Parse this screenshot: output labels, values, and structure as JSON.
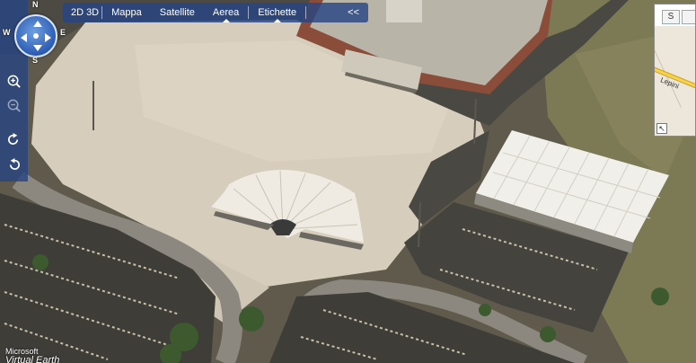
{
  "toolbar": {
    "mode_2d": "2D",
    "mode_3d": "3D",
    "items": [
      {
        "label": "Mappa"
      },
      {
        "label": "Satellite"
      },
      {
        "label": "Aerea"
      },
      {
        "label": "Etichette"
      }
    ],
    "collapse": "<<"
  },
  "compass": {
    "north": "N",
    "south": "S",
    "west": "W",
    "east": "E"
  },
  "nav_icons": [
    "zoom-in-icon",
    "zoom-out-icon",
    "rotate-right-icon",
    "rotate-left-icon"
  ],
  "minimap": {
    "tab_s": "S",
    "road_label": "Lepini",
    "expand_icon": "expand-arrow-icon"
  },
  "logo": {
    "line1": "Microsoft",
    "line2": "Virtual Earth"
  },
  "colors": {
    "toolbar_bg": "#284682",
    "plaza": "#d8cfc0",
    "asphalt": "#3f3d38",
    "grass": "#7a7a52",
    "road_minimap": "#f7d24b"
  }
}
